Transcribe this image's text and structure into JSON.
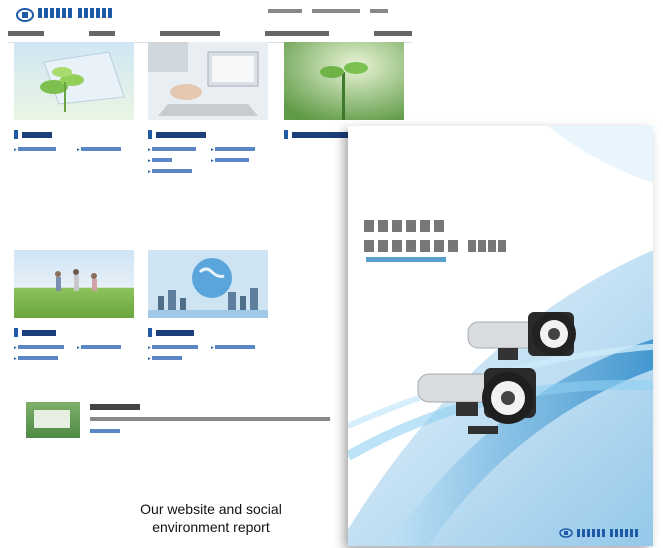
{
  "caption": {
    "line1": "Our website and social",
    "line2": "environment report"
  },
  "colors": {
    "brand": "#1e5aa6",
    "link": "#2a62b8",
    "cover_blue": "#3a9ad8"
  }
}
